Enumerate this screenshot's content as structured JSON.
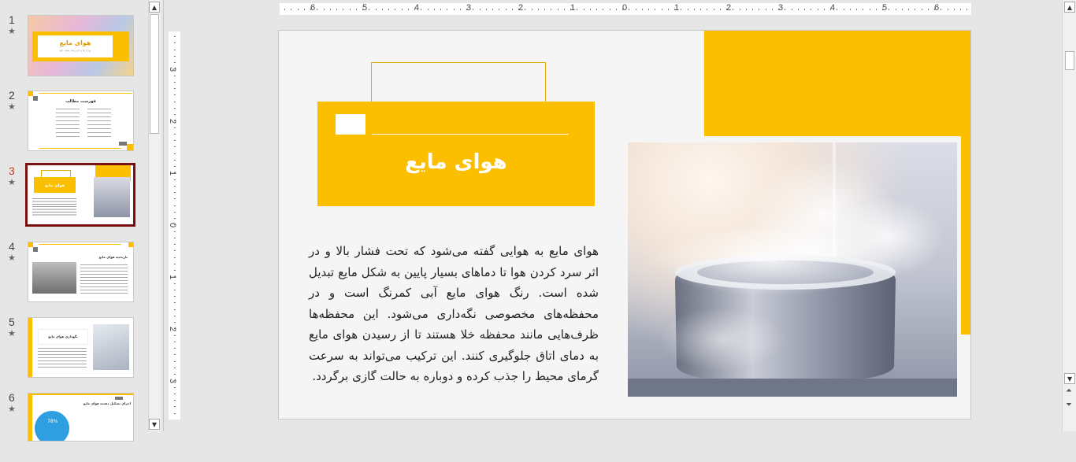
{
  "thumbnails": [
    {
      "number": "1",
      "title": "هوای مایع",
      "subtitle": "ویژگی‌ها و کاربردهای هوای مایع"
    },
    {
      "number": "2",
      "title": "فهرست مطالب"
    },
    {
      "number": "3",
      "title": "هوای مایع"
    },
    {
      "number": "4",
      "title": "تاریخچه هوای مایع"
    },
    {
      "number": "5",
      "title": "نگهداری هوای مایع"
    },
    {
      "number": "6",
      "title": "اجزای تشکیل دهنده هوای مایع",
      "percent": "78%"
    }
  ],
  "selected_slide": "3",
  "ruler": {
    "horizontal_labels": [
      "6",
      "5",
      "4",
      "3",
      "2",
      "1",
      "0",
      "1",
      "2",
      "3",
      "4",
      "5",
      "6"
    ],
    "vertical_labels": [
      "3",
      "2",
      "1",
      "0",
      "1",
      "2",
      "3"
    ]
  },
  "slide": {
    "title": "هوای مایع",
    "body": "هوای مایع به هوایی گفته می‌شود که تحت فشار بالا و در اثر سرد کردن هوا تا دماهای بسیار پایین به شکل مایع تبدیل شده است. رنگ هوای مایع آبی کمرنگ است و در محفظه‌های مخصوصی نگه‌داری می‌شود. این محفظه‌ها ظرف‌هایی مانند محفظه خلا هستند تا از رسیدن هوای مایع به دمای اتاق جلوگیری کنند. این ترکیب می‌تواند به سرعت گرمای محیط را جذب کرده و دوباره به حالت گازی برگردد.",
    "image_icon": "liquid-air-photo"
  },
  "colors": {
    "accent": "#fcbf00",
    "selected_border": "#7a1010",
    "slide_bg": "#f5f5f5"
  }
}
